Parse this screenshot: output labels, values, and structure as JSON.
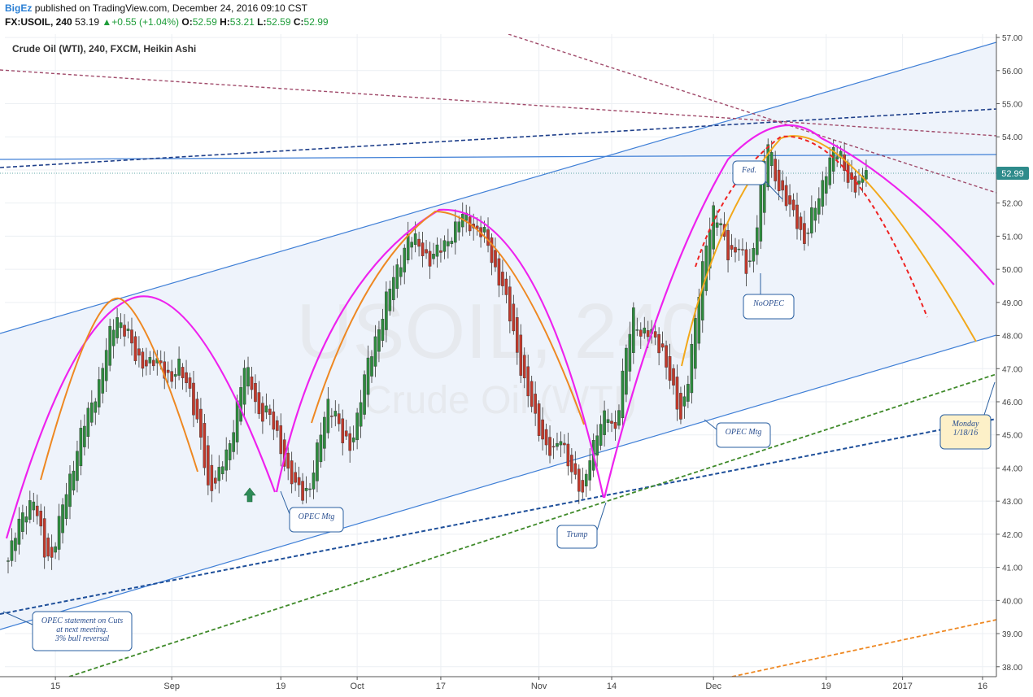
{
  "header": {
    "author": "BigEz",
    "published_text": "published on TradingView.com, December 24, 2016 09:10 CST",
    "symbol": "FX:USOIL, 240",
    "last_price": "53.19",
    "change": "+0.55 (+1.04%)",
    "open_label": "O:",
    "open": "52.59",
    "high_label": "H:",
    "high": "53.21",
    "low_label": "L:",
    "low": "52.59",
    "close_label": "C:",
    "close": "52.99"
  },
  "chart_title": "Crude Oil (WTI), 240, FXCM, Heikin Ashi",
  "watermark": {
    "symbol": "USOIL, 240",
    "name": "Crude Oil (WTI)"
  },
  "colors": {
    "bull": "#2e8b3e",
    "bear": "#c0392b",
    "channel_fill": "#eef3fb",
    "channel_line": "#3f7fd6",
    "arc_magenta": "#ee22ee",
    "arc_orange": "#ee8822",
    "arc_red": "#ee2222",
    "price_label_bg": "#2e8b8b"
  },
  "price_label": "52.99",
  "chart_data": {
    "type": "candlestick",
    "title": "Crude Oil (WTI), 240, FXCM, Heikin Ashi",
    "ylim": [
      37.7,
      57.1
    ],
    "y_ticks": [
      "57.00",
      "56.00",
      "55.00",
      "54.00",
      "53.00",
      "52.00",
      "51.00",
      "50.00",
      "49.00",
      "48.00",
      "47.00",
      "46.00",
      "45.00",
      "44.00",
      "43.00",
      "42.00",
      "41.00",
      "40.00",
      "39.00",
      "38.00"
    ],
    "x_ticks": [
      "15",
      "Sep",
      "19",
      "Oct",
      "17",
      "Nov",
      "14",
      "Dec",
      "19",
      "2017",
      "16"
    ],
    "last_price": 52.99,
    "price_anchors": [
      [
        0,
        41.2
      ],
      [
        4,
        42.7
      ],
      [
        7,
        43.0
      ],
      [
        10,
        41.5
      ],
      [
        12,
        41.3
      ],
      [
        16,
        43.3
      ],
      [
        20,
        45.0
      ],
      [
        25,
        46.6
      ],
      [
        28,
        48.0
      ],
      [
        30,
        48.6
      ],
      [
        33,
        48.0
      ],
      [
        35,
        47.3
      ],
      [
        38,
        47.2
      ],
      [
        42,
        47.1
      ],
      [
        45,
        46.7
      ],
      [
        47,
        47.0
      ],
      [
        50,
        46.4
      ],
      [
        53,
        44.8
      ],
      [
        55,
        43.3
      ],
      [
        58,
        43.9
      ],
      [
        61,
        44.6
      ],
      [
        63,
        46.0
      ],
      [
        65,
        47.1
      ],
      [
        67,
        46.4
      ],
      [
        69,
        45.6
      ],
      [
        71,
        45.8
      ],
      [
        74,
        44.9
      ],
      [
        77,
        43.9
      ],
      [
        79,
        43.4
      ],
      [
        81,
        43.2
      ],
      [
        83,
        43.5
      ],
      [
        86,
        45.0
      ],
      [
        88,
        46.0
      ],
      [
        90,
        45.7
      ],
      [
        92,
        44.8
      ],
      [
        94,
        44.6
      ],
      [
        96,
        45.6
      ],
      [
        98,
        46.7
      ],
      [
        101,
        47.9
      ],
      [
        104,
        49.1
      ],
      [
        107,
        50.0
      ],
      [
        110,
        51.0
      ],
      [
        113,
        50.7
      ],
      [
        116,
        50.3
      ],
      [
        119,
        50.6
      ],
      [
        122,
        51.1
      ],
      [
        125,
        51.6
      ],
      [
        128,
        51.3
      ],
      [
        131,
        51.0
      ],
      [
        134,
        50.0
      ],
      [
        136,
        49.5
      ],
      [
        139,
        48.0
      ],
      [
        142,
        46.6
      ],
      [
        145,
        45.4
      ],
      [
        148,
        44.7
      ],
      [
        150,
        44.4
      ],
      [
        152,
        44.9
      ],
      [
        154,
        44.3
      ],
      [
        156,
        43.6
      ],
      [
        158,
        43.1
      ],
      [
        160,
        44.5
      ],
      [
        163,
        45.3
      ],
      [
        165,
        45.6
      ],
      [
        167,
        45.2
      ],
      [
        170,
        47.5
      ],
      [
        172,
        48.7
      ],
      [
        174,
        48.1
      ],
      [
        177,
        48.0
      ],
      [
        180,
        47.6
      ],
      [
        183,
        46.2
      ],
      [
        185,
        45.5
      ],
      [
        187,
        46.8
      ],
      [
        190,
        49.2
      ],
      [
        192,
        50.9
      ],
      [
        194,
        51.8
      ],
      [
        196,
        51.2
      ],
      [
        198,
        50.5
      ],
      [
        201,
        50.7
      ],
      [
        203,
        49.9
      ],
      [
        205,
        50.6
      ],
      [
        207,
        52.5
      ],
      [
        209,
        53.8
      ],
      [
        211,
        52.8
      ],
      [
        213,
        52.3
      ],
      [
        215,
        51.8
      ],
      [
        217,
        51.4
      ],
      [
        219,
        50.9
      ],
      [
        221,
        51.6
      ],
      [
        223,
        52.1
      ],
      [
        225,
        53.1
      ],
      [
        227,
        53.6
      ],
      [
        229,
        53.3
      ],
      [
        231,
        52.8
      ],
      [
        233,
        52.5
      ],
      [
        235,
        52.6
      ],
      [
        236,
        52.99
      ]
    ],
    "series": [
      {
        "name": "Crude Oil (WTI), 240, FXCM, Heikin Ashi",
        "type": "heikin-ashi"
      }
    ]
  },
  "annotations": [
    {
      "id": "opec1",
      "text_lines": [
        "OPEC Mtg"
      ]
    },
    {
      "id": "trump",
      "text_lines": [
        "Trump"
      ]
    },
    {
      "id": "opec2",
      "text_lines": [
        "OPEC Mtg"
      ]
    },
    {
      "id": "nopec",
      "text_lines": [
        "NoOPEC"
      ]
    },
    {
      "id": "fed",
      "text_lines": [
        "Fed."
      ]
    },
    {
      "id": "opec_stmt",
      "text_lines": [
        "OPEC statement on Cuts",
        "at next meeting.",
        "3% bull reversal"
      ]
    },
    {
      "id": "monday",
      "text_lines": [
        "Monday",
        "1/18/16"
      ]
    }
  ]
}
